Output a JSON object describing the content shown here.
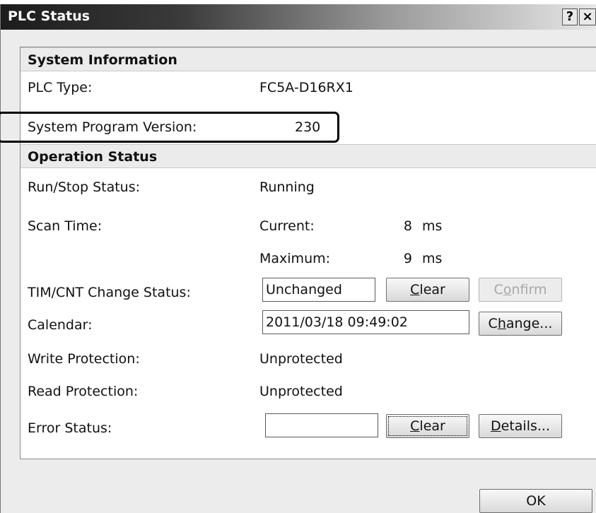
{
  "window": {
    "title": "PLC Status",
    "help_glyph": "?",
    "close_glyph": "×"
  },
  "system_info": {
    "header": "System Information",
    "plc_type_label": "PLC Type:",
    "plc_type_value": "FC5A-D16RX1",
    "program_version_label": "System Program Version:",
    "program_version_value": "230"
  },
  "operation_status": {
    "header": "Operation Status",
    "run_stop_label": "Run/Stop Status:",
    "run_stop_value": "Running",
    "scan_time_label": "Scan Time:",
    "scan_current_label": "Current:",
    "scan_current_value": "8",
    "scan_max_label": "Maximum:",
    "scan_max_value": "9",
    "scan_unit": "ms",
    "timcnt_label": "TIM/CNT Change Status:",
    "timcnt_value": "Unchanged",
    "timcnt_clear_pre": "",
    "timcnt_clear_key": "C",
    "timcnt_clear_post": "lear",
    "confirm_pre": "C",
    "confirm_key": "o",
    "confirm_post": "nfirm",
    "calendar_label": "Calendar:",
    "calendar_value": "2011/03/18 09:49:02",
    "change_pre": "C",
    "change_key": "h",
    "change_post": "ange...",
    "write_protection_label": "Write Protection:",
    "write_protection_value": "Unprotected",
    "read_protection_label": "Read Protection:",
    "read_protection_value": "Unprotected",
    "error_status_label": "Error Status:",
    "error_status_value": "",
    "error_clear_key": "C",
    "error_clear_post": "lear",
    "details_key": "D",
    "details_post": "etails..."
  },
  "footer": {
    "ok_label": "OK"
  }
}
